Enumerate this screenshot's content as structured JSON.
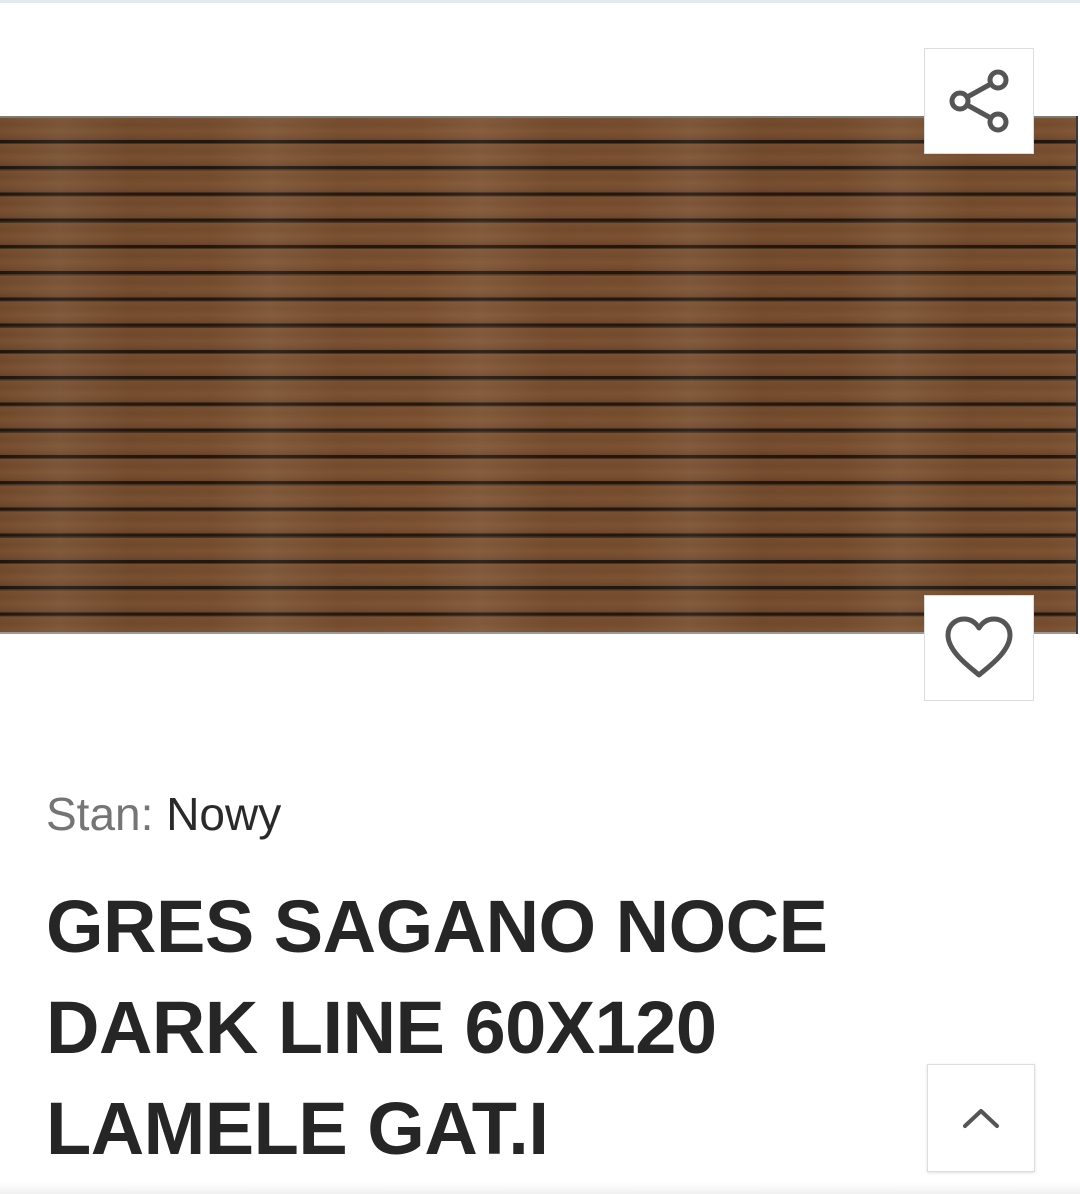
{
  "product": {
    "image_alt": "Płytka gres drewnopodobna z lamelami",
    "condition_label": "Stan:",
    "condition_value": "Nowy",
    "title_lines": [
      "GRES SAGANO NOCE",
      "DARK LINE 60X120",
      "LAMELE GAT.I"
    ]
  },
  "actions": {
    "share_icon": "share-icon",
    "favorite_icon": "heart-icon",
    "scroll_top_icon": "chevron-up-icon"
  },
  "colors": {
    "text_primary": "#262626",
    "text_secondary": "#757575",
    "icon": "#555555",
    "border": "#dcdcdc"
  }
}
